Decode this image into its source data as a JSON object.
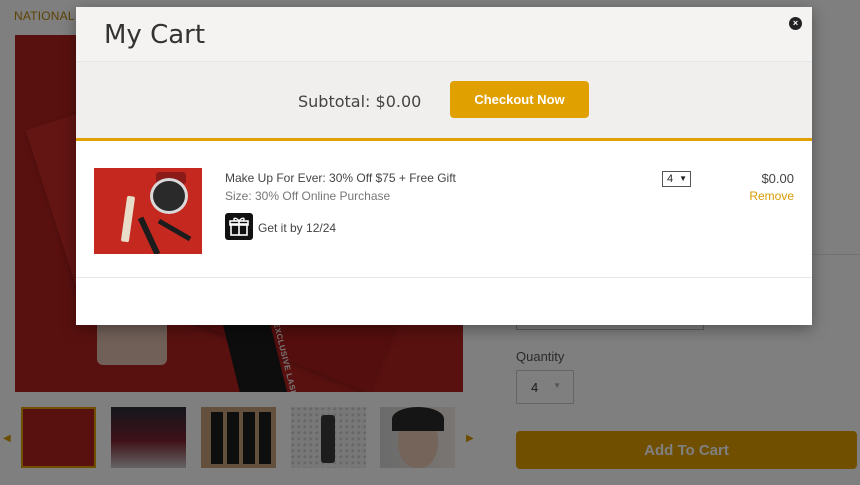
{
  "page": {
    "breadcrumb": "NATIONAL",
    "quantity_label": "Quantity",
    "quantity_value": "4",
    "add_to_cart_label": "Add To Cart",
    "main_image_text": "EXCLUSIVE LASH"
  },
  "modal": {
    "title": "My Cart",
    "subtotal": "Subtotal: $0.00",
    "checkout_label": "Checkout Now",
    "close_icon": "×"
  },
  "cart_item": {
    "name": "Make Up For Ever: 30% Off $75 + Free Gift",
    "size": "Size: 30% Off Online Purchase",
    "delivery": "Get it by 12/24",
    "quantity": "4",
    "price": "$0.00",
    "remove_label": "Remove"
  },
  "colors": {
    "accent": "#e0a000",
    "overlay": "rgba(0,0,0,0.5)",
    "product_red": "#b3221f"
  }
}
